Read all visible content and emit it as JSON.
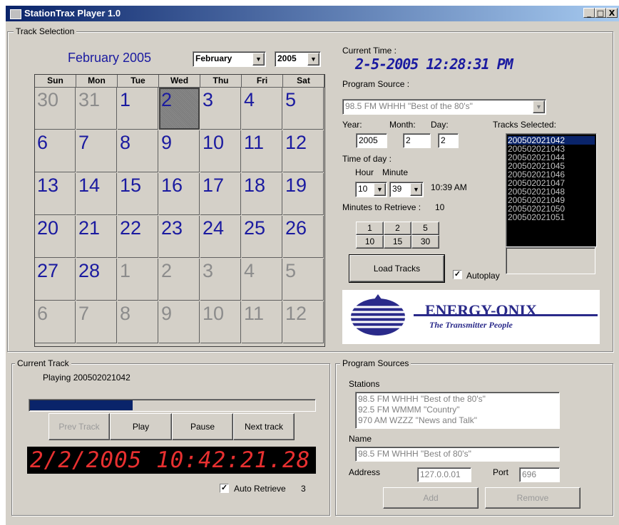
{
  "window": {
    "title": "StationTrax Player 1.0",
    "buttons": [
      "_",
      "□",
      "X"
    ]
  },
  "track_selection": {
    "legend": "Track Selection",
    "month_title": "February 2005",
    "month_select": "February",
    "year_select": "2005",
    "weekdays": [
      "Sun",
      "Mon",
      "Tue",
      "Wed",
      "Thu",
      "Fri",
      "Sat"
    ],
    "weeks": [
      [
        {
          "d": "30",
          "o": true
        },
        {
          "d": "31",
          "o": true
        },
        {
          "d": "1"
        },
        {
          "d": "2",
          "sel": true
        },
        {
          "d": "3"
        },
        {
          "d": "4"
        },
        {
          "d": "5"
        }
      ],
      [
        {
          "d": "6"
        },
        {
          "d": "7"
        },
        {
          "d": "8"
        },
        {
          "d": "9"
        },
        {
          "d": "10"
        },
        {
          "d": "11"
        },
        {
          "d": "12"
        }
      ],
      [
        {
          "d": "13"
        },
        {
          "d": "14"
        },
        {
          "d": "15"
        },
        {
          "d": "16"
        },
        {
          "d": "17"
        },
        {
          "d": "18"
        },
        {
          "d": "19"
        }
      ],
      [
        {
          "d": "20"
        },
        {
          "d": "21"
        },
        {
          "d": "22"
        },
        {
          "d": "23"
        },
        {
          "d": "24"
        },
        {
          "d": "25"
        },
        {
          "d": "26"
        }
      ],
      [
        {
          "d": "27"
        },
        {
          "d": "28"
        },
        {
          "d": "1",
          "o": true
        },
        {
          "d": "2",
          "o": true
        },
        {
          "d": "3",
          "o": true
        },
        {
          "d": "4",
          "o": true
        },
        {
          "d": "5",
          "o": true
        }
      ],
      [
        {
          "d": "6",
          "o": true
        },
        {
          "d": "7",
          "o": true
        },
        {
          "d": "8",
          "o": true
        },
        {
          "d": "9",
          "o": true
        },
        {
          "d": "10",
          "o": true
        },
        {
          "d": "11",
          "o": true
        },
        {
          "d": "12",
          "o": true
        }
      ]
    ],
    "current_time_label": "Current Time :",
    "current_time": "2-5-2005 12:28:31 PM",
    "program_source_label": "Program Source :",
    "program_source": "98.5 FM WHHH \"Best of the 80's\"",
    "year_label": "Year:",
    "month_label": "Month:",
    "day_label": "Day:",
    "year_value": "2005",
    "month_value": "2",
    "day_value": "2",
    "time_of_day_label": "Time of day :",
    "hour_label": "Hour",
    "minute_label": "Minute",
    "hour_value": "10",
    "minute_value": "39",
    "time_display": "10:39 AM",
    "minutes_label": "Minutes to Retrieve :",
    "minutes_value": "10",
    "minute_buttons": [
      "1",
      "2",
      "5",
      "10",
      "15",
      "30"
    ],
    "load_tracks": "Load Tracks",
    "autoplay_label": "Autoplay",
    "autoplay_checked": "✓",
    "tracks_label": "Tracks Selected:",
    "tracks": [
      "200502021042",
      "200502021043",
      "200502021044",
      "200502021045",
      "200502021046",
      "200502021047",
      "200502021048",
      "200502021049",
      "200502021050",
      "200502021051"
    ],
    "logo_text": "ENERGY-ONIX",
    "logo_tagline": "The Transmitter People"
  },
  "current_track": {
    "legend": "Current Track",
    "playing": "Playing 200502021042",
    "progress": 0.36,
    "prev": "Prev Track",
    "play": "Play",
    "pause": "Pause",
    "next": "Next track",
    "led": "2/2/2005 10:42:21.28",
    "auto_retrieve_label": "Auto Retrieve",
    "auto_retrieve_checked": "✓",
    "auto_retrieve_count": "3"
  },
  "program_sources": {
    "legend": "Program Sources",
    "stations_label": "Stations",
    "stations": [
      "98.5 FM WHHH \"Best of the 80's\"",
      "92.5 FM WMMM \"Country\"",
      "970 AM WZZZ \"News and Talk\""
    ],
    "name_label": "Name",
    "name_value": "98.5 FM WHHH \"Best of 80's\"",
    "address_label": "Address",
    "address_value": "127.0.0.01",
    "port_label": "Port",
    "port_value": "696",
    "add": "Add",
    "remove": "Remove"
  },
  "colors": {
    "calendar_text": "#1a1aa0",
    "calendar_other": "#8c8c8c",
    "led": "#e83030",
    "led_bg": "#000000",
    "progress": "#0a246a",
    "selection": "#0a246a"
  }
}
